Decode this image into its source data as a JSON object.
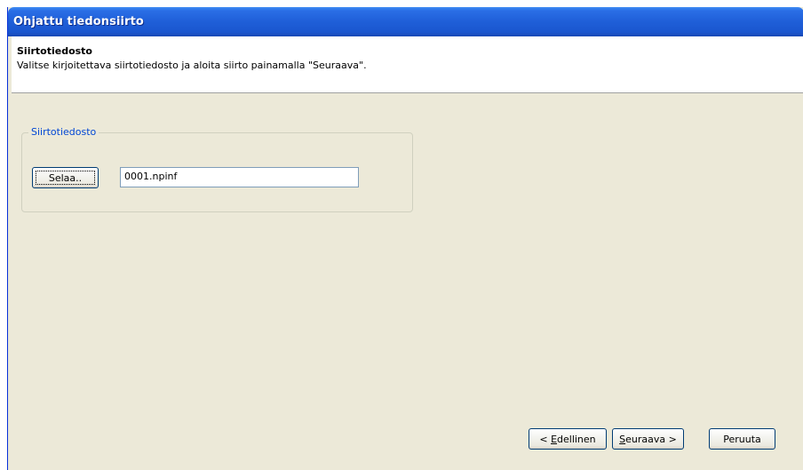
{
  "window": {
    "title": "Ohjattu tiedonsiirto"
  },
  "header": {
    "title": "Siirtotiedosto",
    "subtitle": "Valitse kirjoitettava siirtotiedosto ja aloita siirto painamalla \"Seuraava\"."
  },
  "group": {
    "legend": "Siirtotiedosto",
    "browse_label": "Selaa..",
    "file_value": "0001.npinf"
  },
  "footer": {
    "back_prefix": "< ",
    "back_mnemonic": "E",
    "back_rest": "dellinen",
    "next_mnemonic": "S",
    "next_rest": "euraava >",
    "cancel_label": "Peruuta"
  },
  "colors": {
    "titlebar": "#1f5fd8",
    "dialog_bg": "#ece9d8",
    "legend_text": "#0046d5",
    "button_border": "#003c74"
  }
}
